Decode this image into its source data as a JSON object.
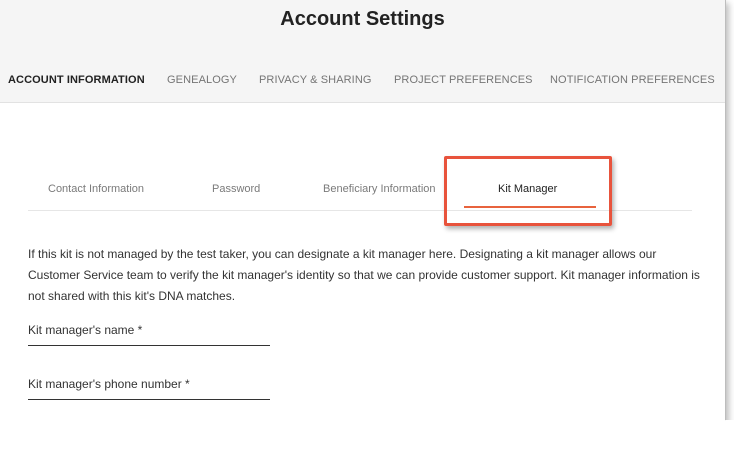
{
  "header": {
    "title": "Account Settings"
  },
  "main_tabs": [
    {
      "label": "Account Information",
      "active": true
    },
    {
      "label": "Genealogy",
      "active": false
    },
    {
      "label": "Privacy & Sharing",
      "active": false
    },
    {
      "label": "Project Preferences",
      "active": false
    },
    {
      "label": "Notification Preferences",
      "active": false
    }
  ],
  "sub_tabs": [
    {
      "label": "Contact Information",
      "active": false
    },
    {
      "label": "Password",
      "active": false
    },
    {
      "label": "Beneficiary Information",
      "active": false
    },
    {
      "label": "Kit Manager",
      "active": true
    }
  ],
  "kit_manager": {
    "description": "If this kit is not managed by the test taker, you can designate a kit manager here. Designating a kit manager allows our Customer Service team to verify the kit manager's identity so that we can provide customer support. Kit manager information is not shared with this kit's DNA matches.",
    "name_field": {
      "label": "Kit manager's name *",
      "value": ""
    },
    "phone_field": {
      "label": "Kit manager's phone number *",
      "value": ""
    }
  },
  "colors": {
    "accent": "#e8633d",
    "highlight_border": "#e8533c",
    "header_bg": "#f5f5f5",
    "text_dark": "#222222",
    "text_muted": "#757575"
  }
}
